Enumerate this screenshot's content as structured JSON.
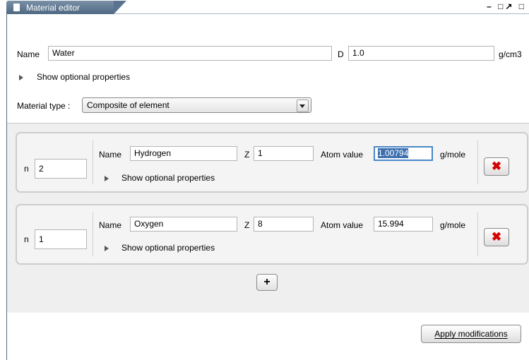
{
  "window": {
    "tab_title": "Material editor",
    "controls": "– □↗ □"
  },
  "material": {
    "name_label": "Name",
    "name_value": "Water",
    "density_label": "D",
    "density_value": "1.0",
    "density_unit": "g/cm3",
    "optional_toggle": "Show optional properties",
    "type_label": "Material type :",
    "type_value": "Composite of element"
  },
  "elements": [
    {
      "n_label": "n",
      "n_value": "2",
      "name_label": "Name",
      "name_value": "Hydrogen",
      "z_label": "Z",
      "z_value": "1",
      "atom_label": "Atom value",
      "atom_value": "1.00794",
      "atom_unit": "g/mole",
      "optional_toggle": "Show optional properties",
      "delete_label": "✖"
    },
    {
      "n_label": "n",
      "n_value": "1",
      "name_label": "Name",
      "name_value": "Oxygen",
      "z_label": "Z",
      "z_value": "8",
      "atom_label": "Atom value",
      "atom_value": "15.994",
      "atom_unit": "g/mole",
      "optional_toggle": "Show optional properties",
      "delete_label": "✖"
    }
  ],
  "add_label": "+",
  "apply_label": "Apply modifications"
}
